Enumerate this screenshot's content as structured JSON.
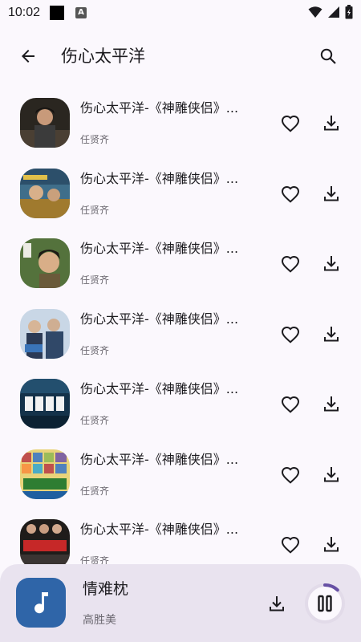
{
  "status_bar": {
    "time": "10:02",
    "notification_badge": "A",
    "icons": [
      "wifi-icon",
      "signal-icon",
      "battery-icon"
    ]
  },
  "header": {
    "title": "伤心太平洋",
    "icons": [
      "arrow-left-icon",
      "search-icon"
    ]
  },
  "songs": [
    {
      "title": "伤心太平洋-《神雕侠侣》...",
      "artist": "任贤齐"
    },
    {
      "title": "伤心太平洋-《神雕侠侣》...",
      "artist": "任贤齐"
    },
    {
      "title": "伤心太平洋-《神雕侠侣》...",
      "artist": "任贤齐"
    },
    {
      "title": "伤心太平洋-《神雕侠侣》...",
      "artist": "任贤齐"
    },
    {
      "title": "伤心太平洋-《神雕侠侣》...",
      "artist": "任贤齐"
    },
    {
      "title": "伤心太平洋-《神雕侠侣》...",
      "artist": "任贤齐"
    },
    {
      "title": "伤心太平洋-《神雕侠侣》...",
      "artist": "任贤齐"
    }
  ],
  "row_icons": [
    "heart-icon",
    "download-icon"
  ],
  "player": {
    "title": "情难枕",
    "artist": "高胜美",
    "progress": 0.12,
    "icons": [
      "music-note-icon",
      "download-icon",
      "pause-icon"
    ],
    "accent_color": "#6750a4",
    "cover_color": "#2f65a8"
  },
  "colors": {
    "background": "#fbf8fd",
    "player_bar": "#e9e3ef",
    "secondary_text": "#6b6870"
  }
}
